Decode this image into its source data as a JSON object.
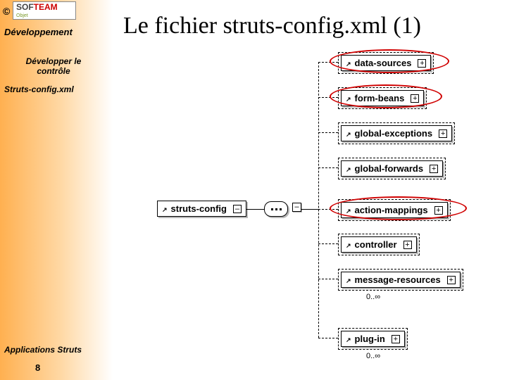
{
  "sidebar": {
    "copyright": "©",
    "logo_brand_a": "SOF",
    "logo_brand_b": "TEAM",
    "logo_tag": "Objet",
    "heading": "Développement",
    "sub1_l1": "Développer le",
    "sub1_l2": "contrôle",
    "sub2": "Struts-config.xml",
    "footer": "Applications Struts",
    "page": "8"
  },
  "title": "Le fichier struts-config.xml (1)",
  "nodes": {
    "root": "struts-config",
    "n0": "data-sources",
    "n1": "form-beans",
    "n2": "global-exceptions",
    "n3": "global-forwards",
    "n4": "action-mappings",
    "n5": "controller",
    "n6": "message-resources",
    "n7": "plug-in"
  },
  "toggles": {
    "minus": "–",
    "plus": "+"
  },
  "arrow": "↗",
  "card1": "0..∞",
  "card2": "0..∞"
}
